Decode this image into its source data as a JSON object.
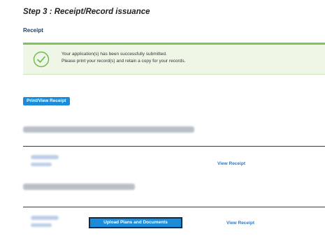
{
  "step_title": "Step 3 : Receipt/Record issuance",
  "section_title": "Receipt",
  "alert": {
    "icon": "check-circle-icon",
    "line1": "Your application(s) has been successfully submitted.",
    "line2": "Please print your record(s) and retain a copy for your records.",
    "accent_color": "#7cc35c",
    "background_color": "#eef7e6"
  },
  "print_button_label": "Print/View Receipt",
  "records": [
    {
      "view_receipt_label": "View Receipt"
    },
    {
      "view_receipt_label": "View Receipt",
      "upload_label": "Upload Plans and Documents"
    }
  ],
  "colors": {
    "button": "#1c8bd8",
    "link": "#2a78c8",
    "heading": "#1f3d6b"
  }
}
